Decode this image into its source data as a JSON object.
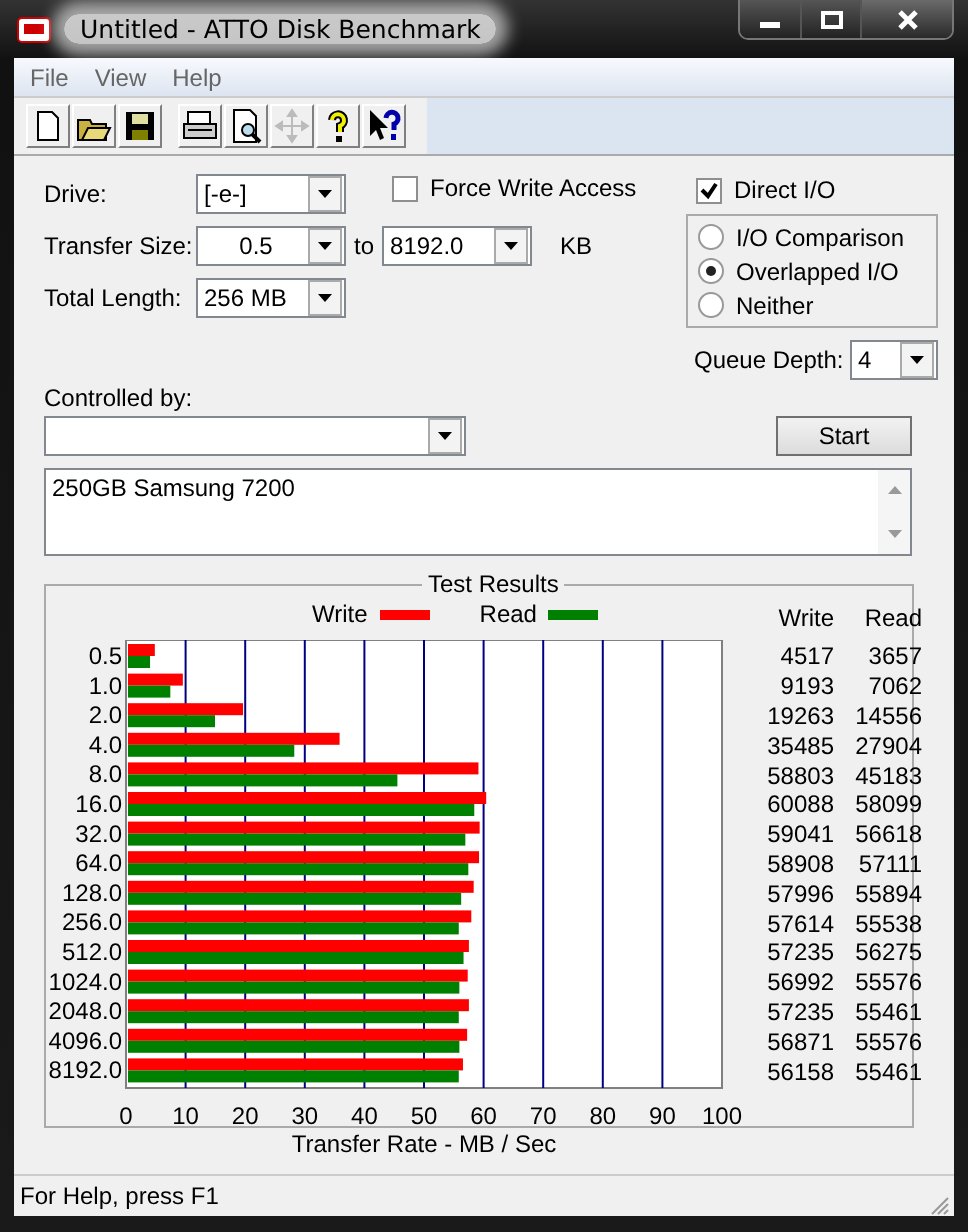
{
  "window": {
    "title": "Untitled - ATTO Disk Benchmark"
  },
  "menu": [
    "File",
    "View",
    "Help"
  ],
  "toolbar": [
    {
      "kind": "new",
      "disabled": false
    },
    {
      "kind": "open",
      "disabled": false
    },
    {
      "kind": "save",
      "disabled": false
    },
    {
      "kind": "print",
      "disabled": false
    },
    {
      "kind": "preview",
      "disabled": false
    },
    {
      "kind": "move",
      "disabled": true
    },
    {
      "kind": "help",
      "disabled": false
    },
    {
      "kind": "context-help",
      "disabled": false
    }
  ],
  "drive": {
    "label": "Drive:",
    "value": "[-e-]"
  },
  "force_write": {
    "label": "Force Write Access",
    "checked": false
  },
  "direct_io": {
    "label": "Direct I/O",
    "checked": true
  },
  "io_modes": [
    {
      "label": "I/O Comparison",
      "selected": false
    },
    {
      "label": "Overlapped I/O",
      "selected": true
    },
    {
      "label": "Neither",
      "selected": false
    }
  ],
  "transfer_size": {
    "label": "Transfer Size:",
    "from": "0.5",
    "to_label": "to",
    "to": "8192.0",
    "unit": "KB"
  },
  "total_length": {
    "label": "Total Length:",
    "value": "256 MB"
  },
  "queue_depth": {
    "label": "Queue Depth:",
    "value": "4"
  },
  "controlled_by": {
    "label": "Controlled by:"
  },
  "start_button": "Start",
  "description": "250GB Samsung 7200",
  "results": {
    "title": "Test Results",
    "table_headers": [
      "Write",
      "Read"
    ],
    "rows": [
      {
        "write": "4517",
        "read": "3657"
      },
      {
        "write": "9193",
        "read": "7062"
      },
      {
        "write": "19263",
        "read": "14556"
      },
      {
        "write": "35485",
        "read": "27904"
      },
      {
        "write": "58803",
        "read": "45183"
      },
      {
        "write": "60088",
        "read": "58099"
      },
      {
        "write": "59041",
        "read": "56618"
      },
      {
        "write": "58908",
        "read": "57111"
      },
      {
        "write": "57996",
        "read": "55894"
      },
      {
        "write": "57614",
        "read": "55538"
      },
      {
        "write": "57235",
        "read": "56275"
      },
      {
        "write": "56992",
        "read": "55576"
      },
      {
        "write": "57235",
        "read": "55461"
      },
      {
        "write": "56871",
        "read": "55576"
      },
      {
        "write": "56158",
        "read": "55461"
      }
    ],
    "chart_data": {
      "type": "bar",
      "orientation": "horizontal",
      "xlabel": "Transfer Rate - MB / Sec",
      "categories": [
        "0.5",
        "1.0",
        "2.0",
        "4.0",
        "8.0",
        "16.0",
        "32.0",
        "64.0",
        "128.0",
        "256.0",
        "512.0",
        "1024.0",
        "2048.0",
        "4096.0",
        "8192.0"
      ],
      "series": [
        {
          "name": "Write",
          "color": "#ff0000",
          "values": [
            4.5,
            9.2,
            19.3,
            35.5,
            58.8,
            60.1,
            59.0,
            58.9,
            58.0,
            57.6,
            57.2,
            57.0,
            57.2,
            56.9,
            56.2
          ]
        },
        {
          "name": "Read",
          "color": "#008000",
          "values": [
            3.7,
            7.1,
            14.6,
            27.9,
            45.2,
            58.1,
            56.6,
            57.1,
            55.9,
            55.5,
            56.3,
            55.6,
            55.5,
            55.6,
            55.5
          ]
        }
      ],
      "grid": true,
      "xlim": [
        0,
        100
      ],
      "xticks": [
        0,
        10,
        20,
        30,
        40,
        50,
        60,
        70,
        80,
        90,
        100
      ]
    }
  },
  "status_bar": "For Help, press F1"
}
